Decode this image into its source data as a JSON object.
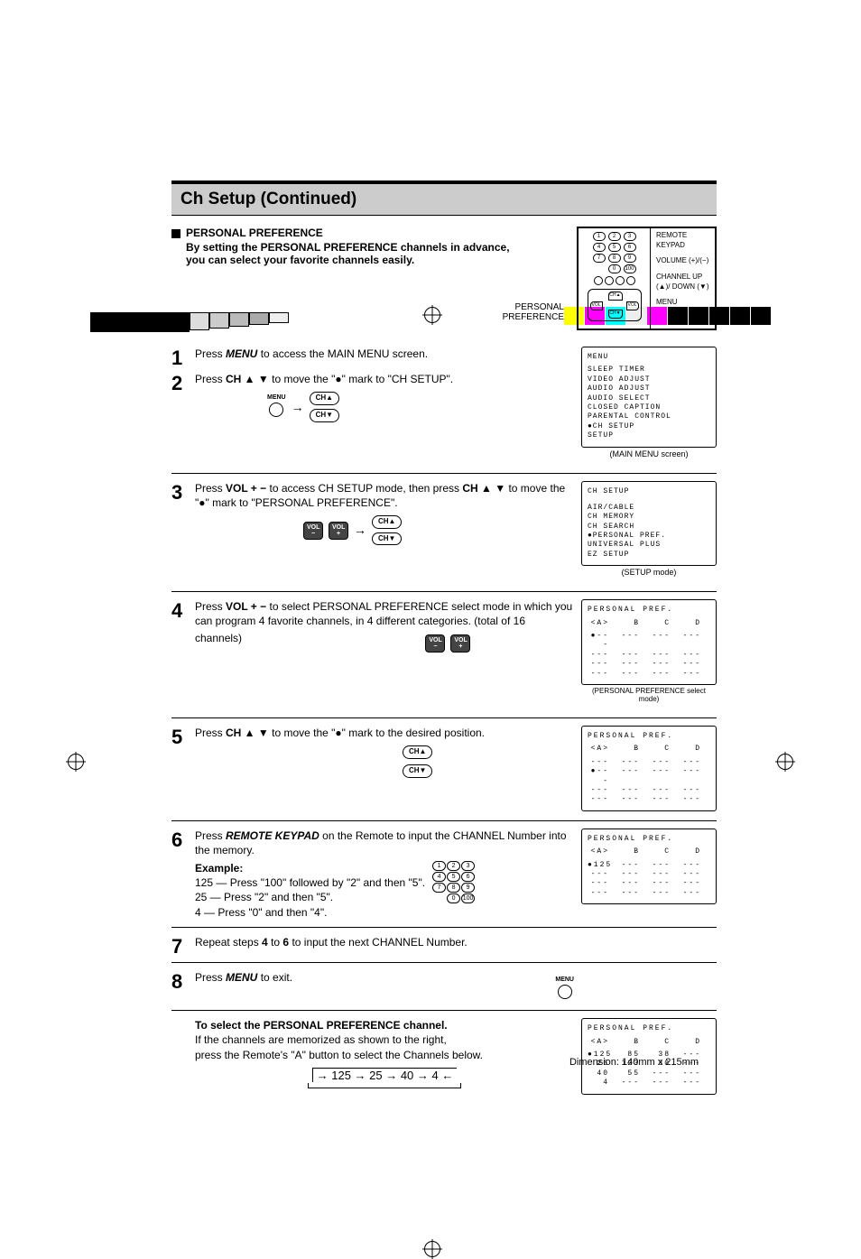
{
  "title": "Ch Setup (Continued)",
  "intro": {
    "heading": "PERSONAL PREFERENCE",
    "desc": "By setting the PERSONAL PREFERENCE channels in advance, you can select your favorite channels easily.",
    "label_line1": "PERSONAL",
    "label_line2": "PREFERENCE"
  },
  "remote_labels": {
    "keypad": "REMOTE KEYPAD",
    "volume": "VOLUME (+)/(−)",
    "channel": "CHANNEL UP (▲)/ DOWN (▼)",
    "menu": "MENU"
  },
  "steps": {
    "s1": {
      "num": "1",
      "text_a": "Press ",
      "menu": "MENU",
      "text_b": " to access the MAIN MENU screen."
    },
    "s2": {
      "num": "2",
      "text_a": "Press ",
      "ch": "CH ▲ ▼",
      "text_b": " to move the \"●\" mark to \"CH SETUP\".",
      "menu_btn": "MENU",
      "chup": "CH▲",
      "chdn": "CH▼"
    },
    "s3": {
      "num": "3",
      "text_a": "Press ",
      "vol": "VOL + −",
      "text_b": " to access CH SETUP mode, then press ",
      "ch": "CH ▲ ▼",
      "text_c": " to move the \"●\" mark to \"PERSONAL PREFERENCE\".",
      "volm": "VOL −",
      "volp": "VOL +",
      "chup": "CH▲",
      "chdn": "CH▼"
    },
    "s4": {
      "num": "4",
      "text_a": "Press ",
      "vol": "VOL + −",
      "text_b": " to select PERSONAL PREFERENCE select mode in which you can program 4 favorite channels, in 4 different categories. (total of 16 channels)",
      "volm": "VOL −",
      "volp": "VOL +"
    },
    "s5": {
      "num": "5",
      "text_a": "Press ",
      "ch": "CH ▲ ▼",
      "text_b": " to move the \"●\" mark to the desired position.",
      "chup": "CH▲",
      "chdn": "CH▼"
    },
    "s6": {
      "num": "6",
      "text_a": "Press ",
      "rk": "REMOTE KEYPAD",
      "text_b": " on the Remote to input the CHANNEL Number into the memory.",
      "ex_label": "Example:",
      "ex1": "125 — Press \"100\" followed by \"2\" and then \"5\".",
      "ex2": "25   — Press \"2\" and then \"5\".",
      "ex3": "4     — Press \"0\" and then \"4\"."
    },
    "s7": {
      "num": "7",
      "text": "Repeat steps 4 to 6 to input the next CHANNEL Number."
    },
    "s8": {
      "num": "8",
      "text_a": "Press ",
      "menu": "MENU",
      "text_b": " to exit.",
      "menu_btn": "MENU"
    }
  },
  "osd": {
    "main_menu": {
      "title": "MENU",
      "items": [
        "SLEEP TIMER",
        "VIDEO ADJUST",
        "AUDIO ADJUST",
        "AUDIO SELECT",
        "CLOSED CAPTION",
        "PARENTAL CONTROL",
        "●CH SETUP",
        "SETUP"
      ],
      "caption": "(MAIN MENU screen)"
    },
    "setup": {
      "title": "CH SETUP",
      "items": [
        "AIR/CABLE",
        "CH MEMORY",
        "CH SEARCH",
        "●PERSONAL PREF.",
        "UNIVERSAL PLUS",
        "EZ SETUP"
      ],
      "caption": "(SETUP mode)"
    },
    "pref_select": {
      "title": "PERSONAL PREF.",
      "cols": [
        "<A>",
        "B",
        "C",
        "D"
      ],
      "rows": [
        [
          "●---",
          "---",
          "---",
          "---"
        ],
        [
          "---",
          "---",
          "---",
          "---"
        ],
        [
          "---",
          "---",
          "---",
          "---"
        ],
        [
          "---",
          "---",
          "---",
          "---"
        ]
      ],
      "caption": "(PERSONAL PREFERENCE select mode)"
    },
    "pref_pos": {
      "title": "PERSONAL PREF.",
      "cols": [
        "<A>",
        "B",
        "C",
        "D"
      ],
      "rows": [
        [
          "---",
          "---",
          "---",
          "---"
        ],
        [
          "●---",
          "---",
          "---",
          "---"
        ],
        [
          "---",
          "---",
          "---",
          "---"
        ],
        [
          "---",
          "---",
          "---",
          "---"
        ]
      ]
    },
    "pref_input": {
      "title": "PERSONAL PREF.",
      "cols": [
        "<A>",
        "B",
        "C",
        "D"
      ],
      "rows": [
        [
          "●125",
          "---",
          "---",
          "---"
        ],
        [
          "---",
          "---",
          "---",
          "---"
        ],
        [
          "---",
          "---",
          "---",
          "---"
        ],
        [
          "---",
          "---",
          "---",
          "---"
        ]
      ]
    },
    "pref_final": {
      "title": "PERSONAL PREF.",
      "cols": [
        "<A>",
        "B",
        "C",
        "D"
      ],
      "rows": [
        [
          "●125",
          "85",
          "38",
          "---"
        ],
        [
          "25",
          "123",
          "30",
          "---"
        ],
        [
          "40",
          "55",
          "---",
          "---"
        ],
        [
          "4",
          "---",
          "---",
          "---"
        ]
      ]
    }
  },
  "select_section": {
    "heading": "To select the PERSONAL PREFERENCE channel.",
    "line1": "If the channels are memorized as shown to the right,",
    "line2": "press the Remote's \"A\" button to select the Channels below.",
    "cycle": "125 → 25 → 40 → 4"
  },
  "footer": "Dimension: 140mm x 215mm",
  "keypad": {
    "keys": [
      [
        "1",
        "2",
        "3"
      ],
      [
        "4",
        "5",
        "6"
      ],
      [
        "7",
        "8",
        "9"
      ],
      [
        "",
        "0",
        "100"
      ]
    ]
  }
}
